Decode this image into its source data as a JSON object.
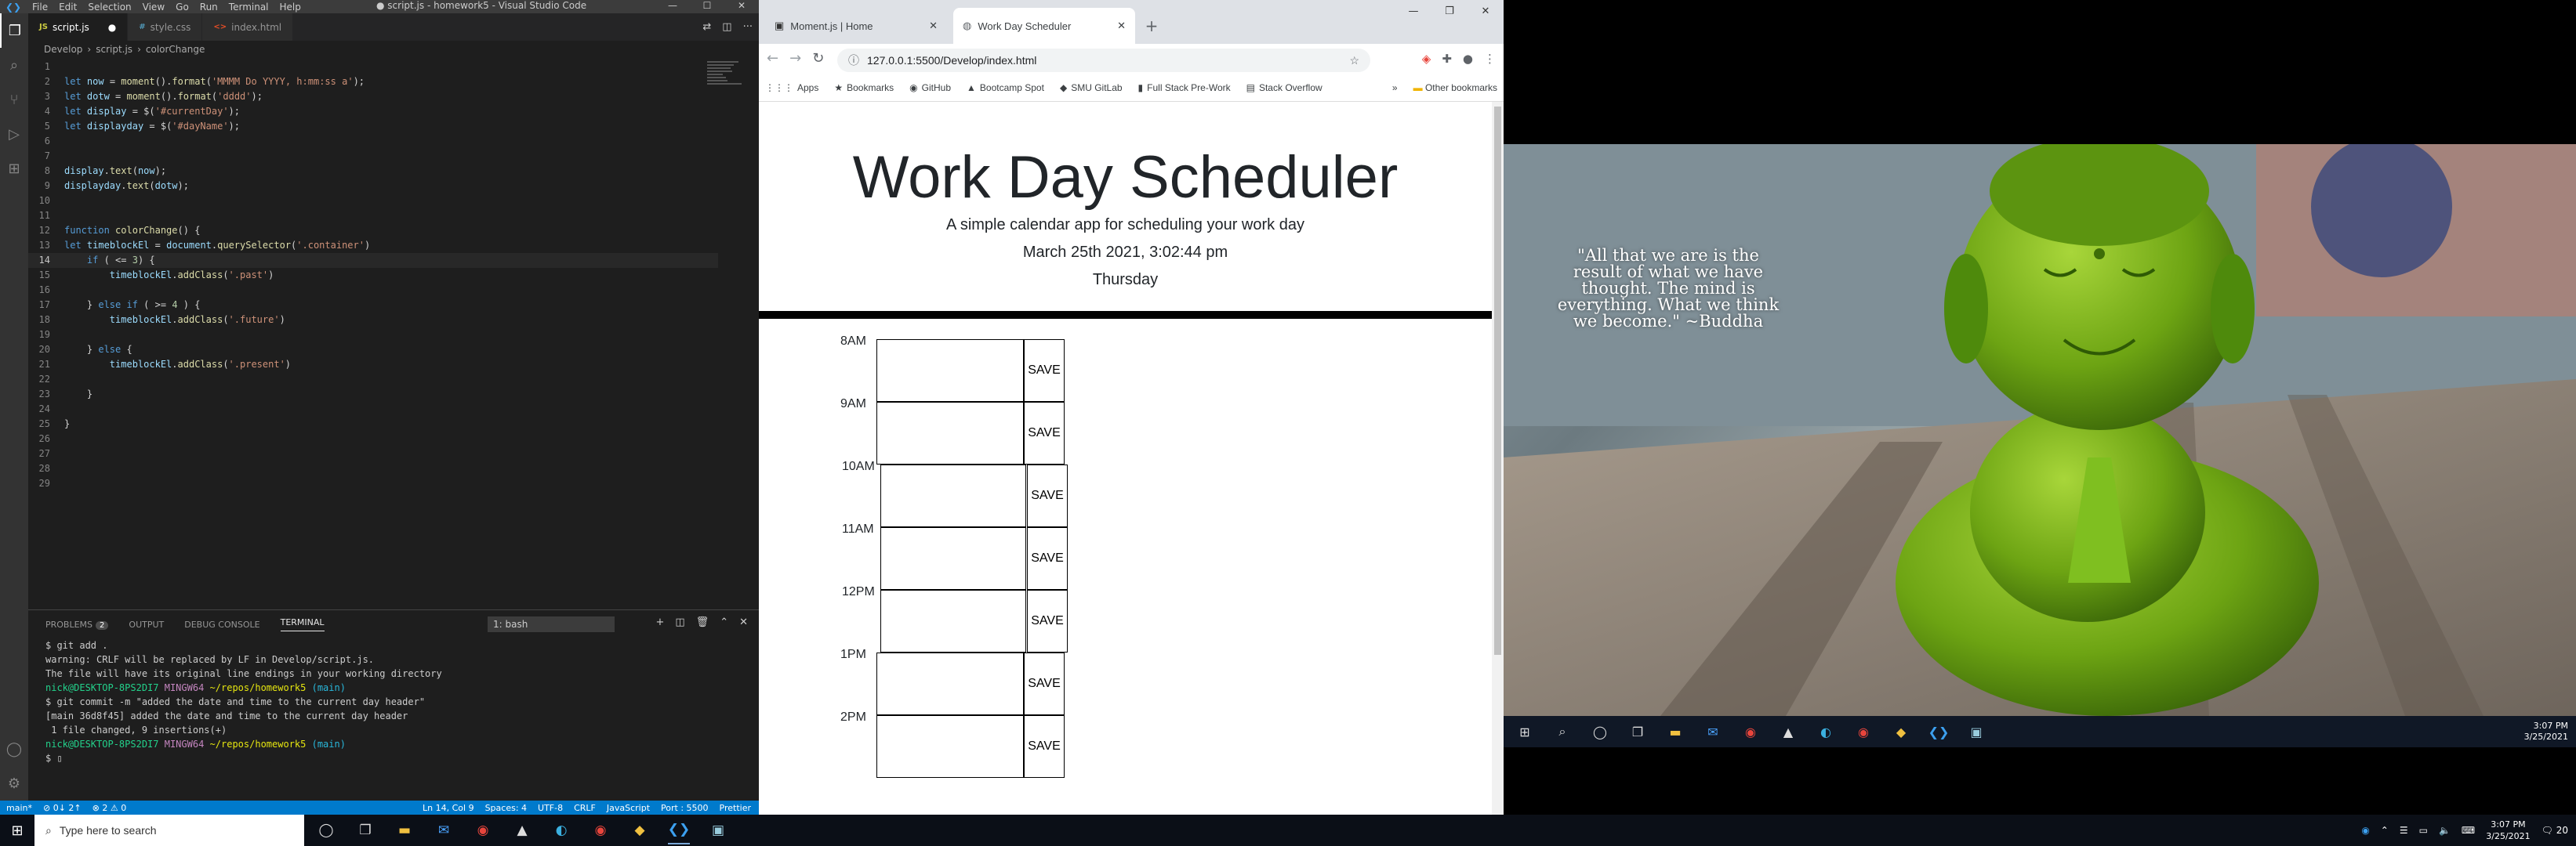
{
  "vscode": {
    "window_title": "● script.js - homework5 - Visual Studio Code",
    "menu": [
      "File",
      "Edit",
      "Selection",
      "View",
      "Go",
      "Run",
      "Terminal",
      "Help"
    ],
    "tabs": [
      {
        "label": "script.js",
        "ext": "JS",
        "ext_color": "#cbcb41",
        "active": true,
        "modified": true
      },
      {
        "label": "style.css",
        "ext": "#",
        "ext_color": "#519aba",
        "active": false
      },
      {
        "label": "index.html",
        "ext": "<>",
        "ext_color": "#e44d26",
        "active": false
      }
    ],
    "breadcrumb": [
      "Develop",
      "script.js",
      "colorChange"
    ],
    "code": [
      "",
      "let now = moment().format('MMMM Do YYYY, h:mm:ss a');",
      "let dotw = moment().format('dddd');",
      "let display = $('#currentDay');",
      "let displayday = $('#dayName');",
      "",
      "",
      "display.text(now);",
      "displayday.text(dotw);",
      "",
      "",
      "function colorChange() {",
      "let timeblockEl = document.querySelector('.container')",
      "    if ( <= 3) {",
      "        timeblockEl.addClass('.past')",
      "",
      "    } else if ( >= 4 ) {",
      "        timeblockEl.addClass('.future')",
      "",
      "    } else {",
      "        timeblockEl.addClass('.present')",
      "",
      "    }",
      "",
      "}",
      "",
      "",
      "",
      ""
    ],
    "current_line": 14,
    "panel_tabs": [
      "PROBLEMS",
      "OUTPUT",
      "DEBUG CONSOLE",
      "TERMINAL"
    ],
    "problems_count": "2",
    "terminal_select": "1: bash",
    "terminal_lines": [
      {
        "text": "$ git add .",
        "cls": ""
      },
      {
        "text": "warning: CRLF will be replaced by LF in Develop/script.js.",
        "cls": ""
      },
      {
        "text": "The file will have its original line endings in your working directory",
        "cls": ""
      },
      {
        "text": "",
        "cls": ""
      },
      {
        "text": "nick@DESKTOP-8PS2DI7 MINGW64 ~/repos/homework5 (main)",
        "cls": "prompt"
      },
      {
        "text": "$ git commit -m \"added the date and time to the current day header\"",
        "cls": ""
      },
      {
        "text": "[main 36d8f45] added the date and time to the current day header",
        "cls": ""
      },
      {
        "text": " 1 file changed, 9 insertions(+)",
        "cls": ""
      },
      {
        "text": "",
        "cls": ""
      },
      {
        "text": "nick@DESKTOP-8PS2DI7 MINGW64 ~/repos/homework5 (main)",
        "cls": "prompt"
      },
      {
        "text": "$ ▯",
        "cls": ""
      }
    ],
    "status_left": [
      "main*",
      "⊘ 0↓ 2↑",
      "⊗ 2 ⚠ 0"
    ],
    "status_right": [
      "Ln 14, Col 9",
      "Spaces: 4",
      "UTF-8",
      "CRLF",
      "JavaScript",
      "Port : 5500",
      "Prettier"
    ]
  },
  "chrome": {
    "tabs": [
      {
        "label": "Moment.js | Home",
        "active": false
      },
      {
        "label": "Work Day Scheduler",
        "active": true
      }
    ],
    "url": "127.0.0.1:5500/Develop/index.html",
    "bookmarks": [
      "Apps",
      "Bookmarks",
      "GitHub",
      "Bootcamp Spot",
      "SMU GitLab",
      "Full Stack Pre-Work",
      "Stack Overflow"
    ],
    "other_bookmarks": "Other bookmarks",
    "page": {
      "title": "Work Day Scheduler",
      "lead": "A simple calendar app for scheduling your work day",
      "current_day": "March 25th 2021, 3:02:44 pm",
      "day_name": "Thursday",
      "hours": [
        "8AM",
        "9AM",
        "10AM",
        "11AM",
        "12PM",
        "1PM",
        "2PM"
      ],
      "save_label": "SAVE"
    }
  },
  "desktop": {
    "quote": "\"All that we are is the result of what we have thought. The mind is everything. What we think we become.\" ~Buddha",
    "inner_clock_time": "3:07 PM",
    "inner_clock_date": "3/25/2021"
  },
  "taskbar": {
    "search_placeholder": "Type here to search",
    "time": "3:07 PM",
    "date": "3/25/2021",
    "notification_count": "20"
  }
}
